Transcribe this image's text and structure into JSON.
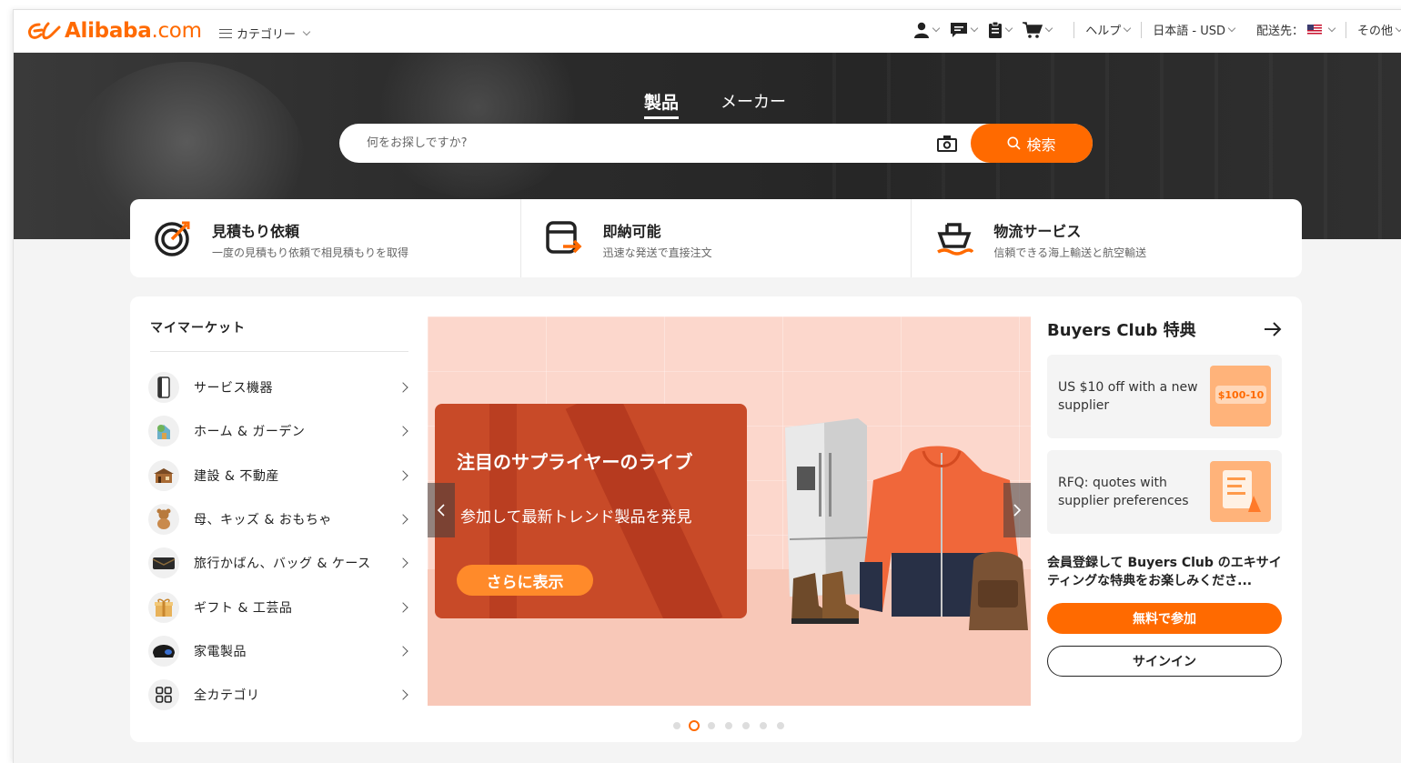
{
  "header": {
    "logo_brand": "Alibaba",
    "logo_suffix": ".com",
    "category_menu": "カテゴリー",
    "help": "ヘルプ",
    "language_currency": "日本語 - USD",
    "ship_to": "配送先：",
    "more": "その他",
    "icons": [
      "user-icon",
      "message-icon",
      "orders-icon",
      "cart-icon"
    ]
  },
  "hero": {
    "tabs": [
      "製品",
      "メーカー"
    ],
    "search_placeholder": "何をお探しですか?",
    "search_button": "検索"
  },
  "features": [
    {
      "title": "見積もり依頼",
      "subtitle": "一度の見積もり依頼で相見積もりを取得",
      "icon": "target-icon"
    },
    {
      "title": "即納可能",
      "subtitle": "迅速な発送で直接注文",
      "icon": "fast-dispatch-icon"
    },
    {
      "title": "物流サービス",
      "subtitle": "信頼できる海上輸送と航空輸送",
      "icon": "ship-icon"
    }
  ],
  "market": {
    "title": "マイマーケット",
    "categories": [
      {
        "label": "サービス機器",
        "icon": "service-equipment-icon"
      },
      {
        "label": "ホーム & ガーデン",
        "icon": "home-garden-icon"
      },
      {
        "label": "建設 & 不動産",
        "icon": "construction-icon"
      },
      {
        "label": "母、キッズ & おもちゃ",
        "icon": "toy-icon"
      },
      {
        "label": "旅行かばん、バッグ & ケース",
        "icon": "bag-icon"
      },
      {
        "label": "ギフト & 工芸品",
        "icon": "gift-icon"
      },
      {
        "label": "家電製品",
        "icon": "appliance-icon"
      },
      {
        "label": "全カテゴリ",
        "icon": "grid-icon"
      }
    ]
  },
  "banner": {
    "title": "注目のサプライヤーのライブ",
    "subtitle": "参加して最新トレンド製品を発見",
    "button": "さらに表示",
    "slide_count": 7,
    "active_slide": 2
  },
  "buyers_club": {
    "title": "Buyers Club 特典",
    "cards": [
      {
        "text": "US $10 off with a new supplier",
        "badge": "$100-10"
      },
      {
        "text": "RFQ: quotes with supplier preferences"
      }
    ],
    "description": "会員登録して Buyers Club のエキサイティングな特典をお楽しみくださ...",
    "join_button": "無料で参加",
    "signin_button": "サインイン"
  },
  "colors": {
    "brand": "#ff6a00",
    "banner_bg": "#fcd7cc",
    "promo_bg": "#c84a28"
  }
}
